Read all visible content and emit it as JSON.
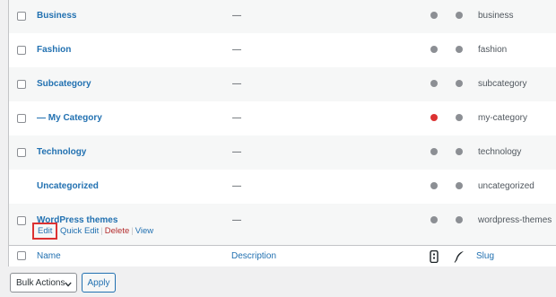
{
  "rows": [
    {
      "name": "Business",
      "description": "—",
      "slug": "business",
      "status_color": "#8c8f94"
    },
    {
      "name": "Fashion",
      "description": "—",
      "slug": "fashion",
      "status_color": "#8c8f94"
    },
    {
      "name": "Subcategory",
      "description": "—",
      "slug": "subcategory",
      "status_color": "#8c8f94"
    },
    {
      "name": "— My Category",
      "description": "—",
      "slug": "my-category",
      "status_color": "#dc3232"
    },
    {
      "name": "Technology",
      "description": "—",
      "slug": "technology",
      "status_color": "#8c8f94"
    },
    {
      "name": "Uncategorized",
      "description": "—",
      "slug": "uncategorized",
      "status_color": "#8c8f94"
    },
    {
      "name": "WordPress themes",
      "description": "—",
      "slug": "wordpress-themes",
      "status_color": "#8c8f94"
    }
  ],
  "row_actions": {
    "edit": "Edit",
    "quick_edit": "Quick Edit",
    "delete": "Delete",
    "view": "View",
    "separator": "|"
  },
  "footer": {
    "name": "Name",
    "description": "Description",
    "slug": "Slug",
    "col_icon_1": "mobile-icon",
    "col_icon_2": "feather-icon"
  },
  "bulk_actions": {
    "selected": "Bulk Actions",
    "apply": "Apply"
  },
  "colors": {
    "link": "#2271b1",
    "delete": "#b32d2e",
    "highlight_border": "#dc3232",
    "dot_gray": "#8c8f94",
    "dot_red": "#dc3232"
  }
}
